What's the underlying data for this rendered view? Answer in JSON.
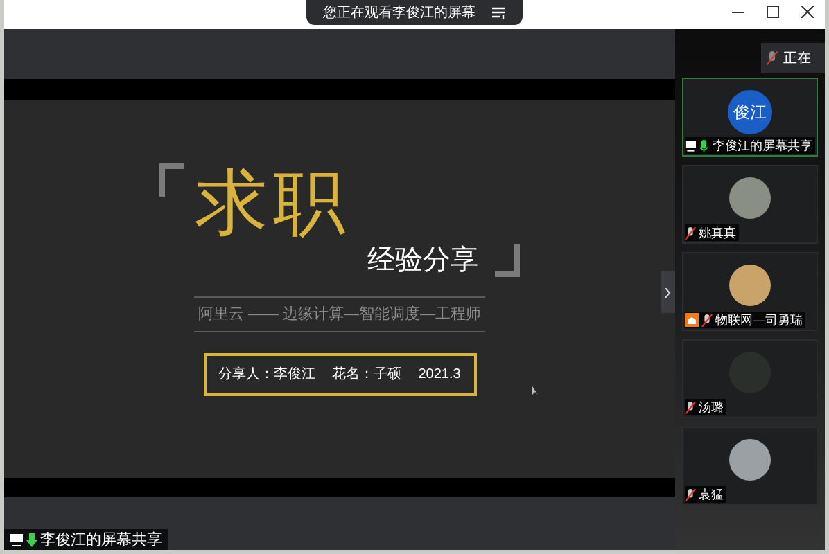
{
  "window": {
    "banner": "您正在观看李俊江的屏幕"
  },
  "slide": {
    "title": "求职",
    "subtitle": "经验分享",
    "tagline": "阿里云 —— 边缘计算—智能调度—工程师",
    "presenter": "分享人：李俊江",
    "nickname": "花名：子硕",
    "date": "2021.3"
  },
  "share_label": "李俊江的屏幕共享",
  "speaking_tooltip": "正在",
  "participants": [
    {
      "name": "李俊江的屏幕共享",
      "kind": "initials",
      "initials": "俊江",
      "muted": false,
      "active": true,
      "sharing": true,
      "hand_raised": false
    },
    {
      "name": "姚真真",
      "kind": "photo",
      "muted": true,
      "active": false,
      "sharing": false,
      "hand_raised": false
    },
    {
      "name": "物联网—司勇瑞",
      "kind": "photo",
      "muted": true,
      "active": false,
      "sharing": false,
      "hand_raised": true
    },
    {
      "name": "汤璐",
      "kind": "photo",
      "muted": true,
      "active": false,
      "sharing": false,
      "hand_raised": false
    },
    {
      "name": "袁猛",
      "kind": "photo",
      "muted": true,
      "active": false,
      "sharing": false,
      "hand_raised": false
    }
  ]
}
